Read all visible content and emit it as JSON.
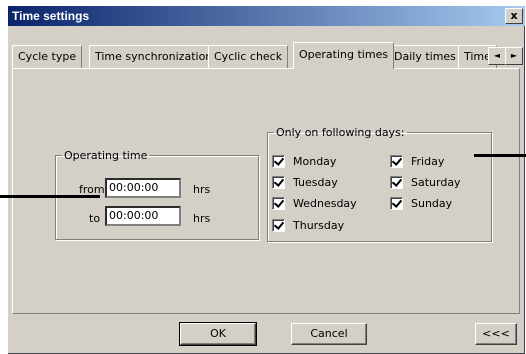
{
  "window": {
    "title": "Time settings",
    "close_label": "x"
  },
  "tabs": [
    {
      "label": "Cycle type"
    },
    {
      "label": "Time synchronization"
    },
    {
      "label": "Cyclic check"
    },
    {
      "label": "Operating times"
    },
    {
      "label": "Daily times"
    },
    {
      "label": "Time"
    }
  ],
  "tab_scroll": {
    "left": "◄",
    "right": "►"
  },
  "operating_time": {
    "legend": "Operating time",
    "from_label": "from",
    "from_value": "00:00:00",
    "to_label": "to",
    "to_value": "00:00:00",
    "unit": "hrs"
  },
  "days": {
    "legend": "Only on following days:",
    "items": [
      {
        "label": "Monday"
      },
      {
        "label": "Tuesday"
      },
      {
        "label": "Wednesday"
      },
      {
        "label": "Thursday"
      },
      {
        "label": "Friday"
      },
      {
        "label": "Saturday"
      },
      {
        "label": "Sunday"
      }
    ]
  },
  "buttons": {
    "ok": "OK",
    "cancel": "Cancel",
    "collapse": "<<<"
  }
}
